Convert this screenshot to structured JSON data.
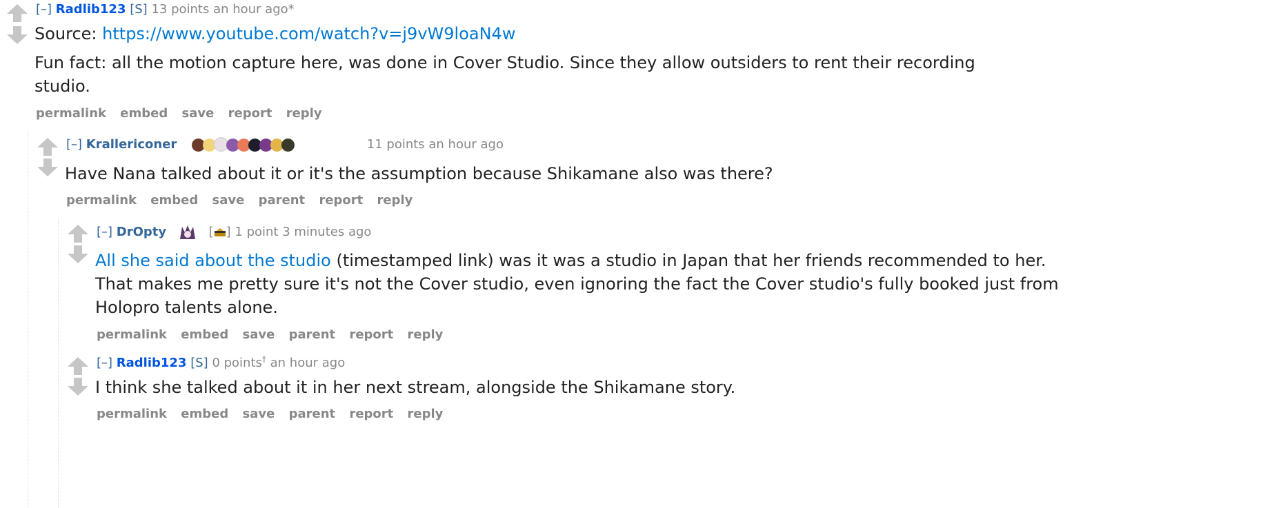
{
  "comments": [
    {
      "expand": "[–]",
      "author": "Radlib123",
      "submitter": "[S]",
      "meta": "13 points an hour ago*",
      "body_prefix": "Source: ",
      "link": "https://www.youtube.com/watch?v=j9vW9loaN4w",
      "body": "Fun fact: all the motion capture here, was done in Cover Studio. Since they allow outsiders to rent their recording studio.",
      "buttons": [
        "permalink",
        "embed",
        "save",
        "report",
        "reply"
      ]
    },
    {
      "expand": "[–]",
      "author": "Krallericoner",
      "meta": "11 points an hour ago",
      "flair_colors": [
        "#6b3a2a",
        "#f1d37a",
        "#e8e0e6",
        "#8b5aa8",
        "#e97a5a",
        "#1d1d2b",
        "#7a3a8a",
        "#e2b44a",
        "#3a3a2a"
      ],
      "body": "Have Nana talked about it or it's the assumption because Shikamane also was there?",
      "buttons": [
        "permalink",
        "embed",
        "save",
        "parent",
        "report",
        "reply"
      ]
    },
    {
      "expand": "[–]",
      "author": "DrOpty",
      "flair_bracket_open": "[",
      "flair_bracket_close": "]",
      "meta": "1 point 3 minutes ago",
      "link": "All she said about the studio",
      "body": " (timestamped link) was it was a studio in Japan that her friends recommended to her. That makes me pretty sure it's not the Cover studio, even ignoring the fact the Cover studio's fully booked just from Holopro talents alone.",
      "buttons": [
        "permalink",
        "embed",
        "save",
        "parent",
        "report",
        "reply"
      ]
    },
    {
      "expand": "[–]",
      "author": "Radlib123",
      "submitter": "[S]",
      "points": "0 points",
      "dagger": "†",
      "time": " an hour ago",
      "body": "I think she talked about it in her next stream, alongside the Shikamane story.",
      "buttons": [
        "permalink",
        "embed",
        "save",
        "parent",
        "report",
        "reply"
      ]
    }
  ]
}
